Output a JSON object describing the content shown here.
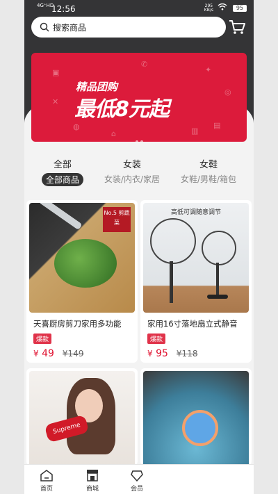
{
  "status": {
    "time": "12:56",
    "network": "4G⁺HD",
    "speed_value": "295",
    "speed_unit": "KB/s",
    "battery": "95"
  },
  "search": {
    "placeholder": "搜索商品"
  },
  "banner": {
    "line1": "精品团购",
    "line2": "最低8元起"
  },
  "tabs": [
    {
      "title": "全部",
      "subtitle": "全部商品"
    },
    {
      "title": "女装",
      "subtitle": "女装/内衣/家居"
    },
    {
      "title": "女鞋",
      "subtitle": "女鞋/男鞋/箱包"
    }
  ],
  "products": [
    {
      "name": "天喜厨房剪刀家用多功能",
      "badge": "爆款",
      "currency": "¥",
      "price": "49",
      "old_price": "¥149",
      "overlay_label": "No.5 剪蔬菜"
    },
    {
      "name": "家用16寸落地扇立式静音",
      "badge": "爆款",
      "currency": "¥",
      "price": "95",
      "old_price": "¥118",
      "overlay_label": "高低可调随意调节"
    },
    {
      "name": "",
      "overlay_label": "Supreme"
    },
    {
      "name": "",
      "overlay_label": ""
    }
  ],
  "nav": [
    {
      "label": "首页",
      "icon": "home-icon"
    },
    {
      "label": "商城",
      "icon": "shop-icon"
    },
    {
      "label": "会员",
      "icon": "member-icon"
    }
  ],
  "colors": {
    "accent": "#dc1b3b",
    "header": "#343436",
    "price": "#e0102f"
  }
}
